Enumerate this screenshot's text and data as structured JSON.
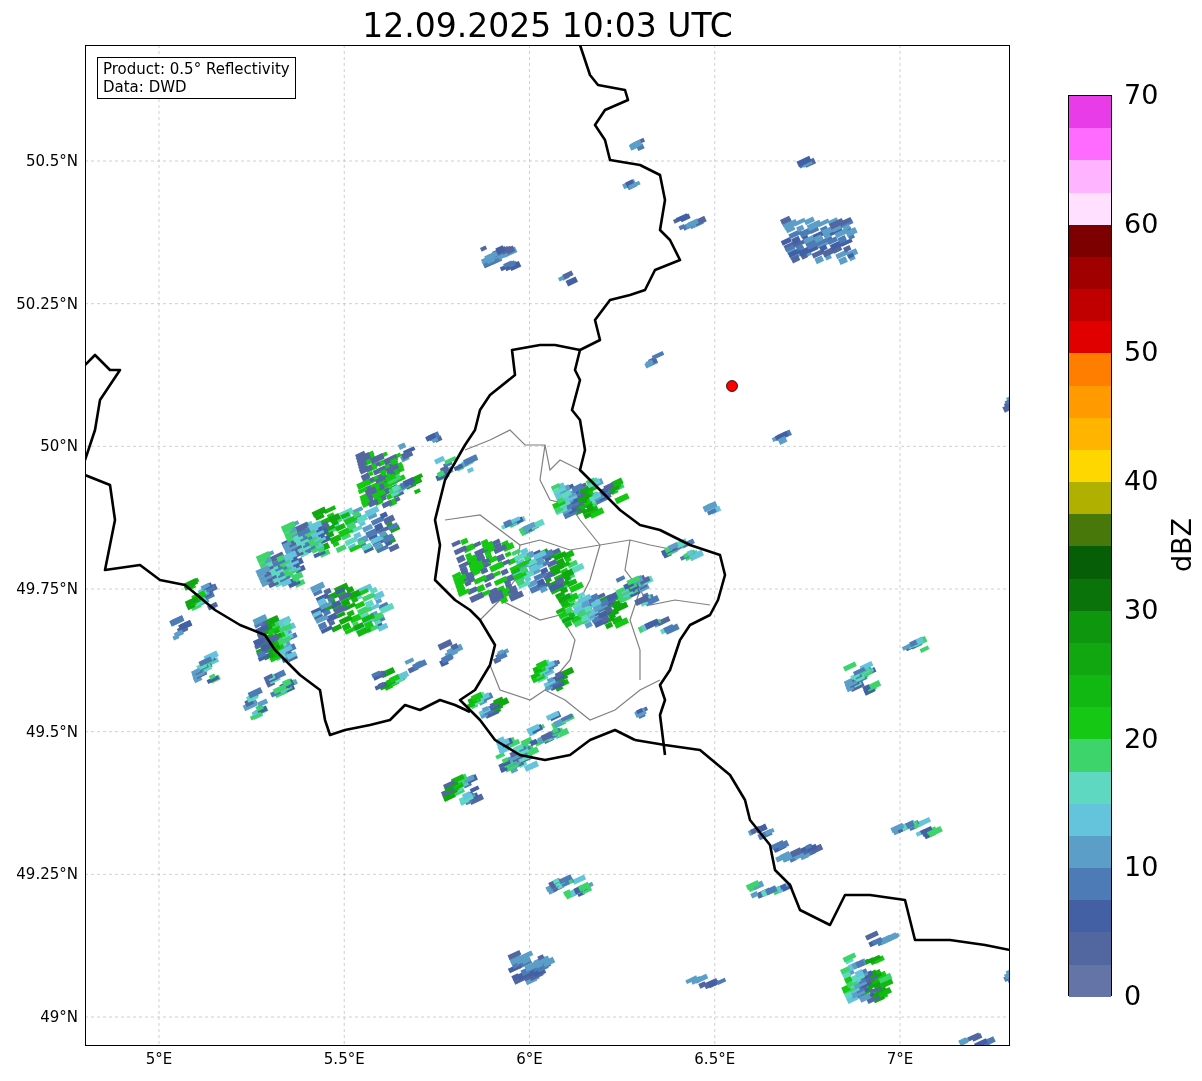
{
  "title": "12.09.2025 10:03 UTC",
  "map": {
    "info_lines": [
      "Product: 0.5° Reflectivity",
      "Data: DWD"
    ],
    "lon_ticks": [
      "5°E",
      "5.5°E",
      "6°E",
      "6.5°E",
      "7°E"
    ],
    "lat_ticks": [
      "50.5°N",
      "50.25°N",
      "50°N",
      "49.75°N",
      "49.5°N",
      "49.25°N",
      "49°N"
    ]
  },
  "colorbar": {
    "label": "dBZ",
    "ticks": [
      "70",
      "60",
      "50",
      "40",
      "30",
      "20",
      "10",
      "0"
    ],
    "bins": [
      {
        "color": "#6474a6"
      },
      {
        "color": "#5267a0"
      },
      {
        "color": "#4360a5"
      },
      {
        "color": "#4c7bb5"
      },
      {
        "color": "#5b9ec8"
      },
      {
        "color": "#63c4dc"
      },
      {
        "color": "#5fd8c2"
      },
      {
        "color": "#3dd46c"
      },
      {
        "color": "#14c814"
      },
      {
        "color": "#12b812"
      },
      {
        "color": "#10a710"
      },
      {
        "color": "#0e960e"
      },
      {
        "color": "#0a740a"
      },
      {
        "color": "#065f06"
      },
      {
        "color": "#48780a"
      },
      {
        "color": "#b0b000"
      },
      {
        "color": "#ffd700"
      },
      {
        "color": "#ffb400"
      },
      {
        "color": "#ff9a00"
      },
      {
        "color": "#ff7e00"
      },
      {
        "color": "#e00000"
      },
      {
        "color": "#c00000"
      },
      {
        "color": "#a00000"
      },
      {
        "color": "#7c0000"
      },
      {
        "color": "#ffe0ff"
      },
      {
        "color": "#ffb4ff"
      },
      {
        "color": "#ff6aff"
      },
      {
        "color": "#e83ce8"
      }
    ]
  }
}
